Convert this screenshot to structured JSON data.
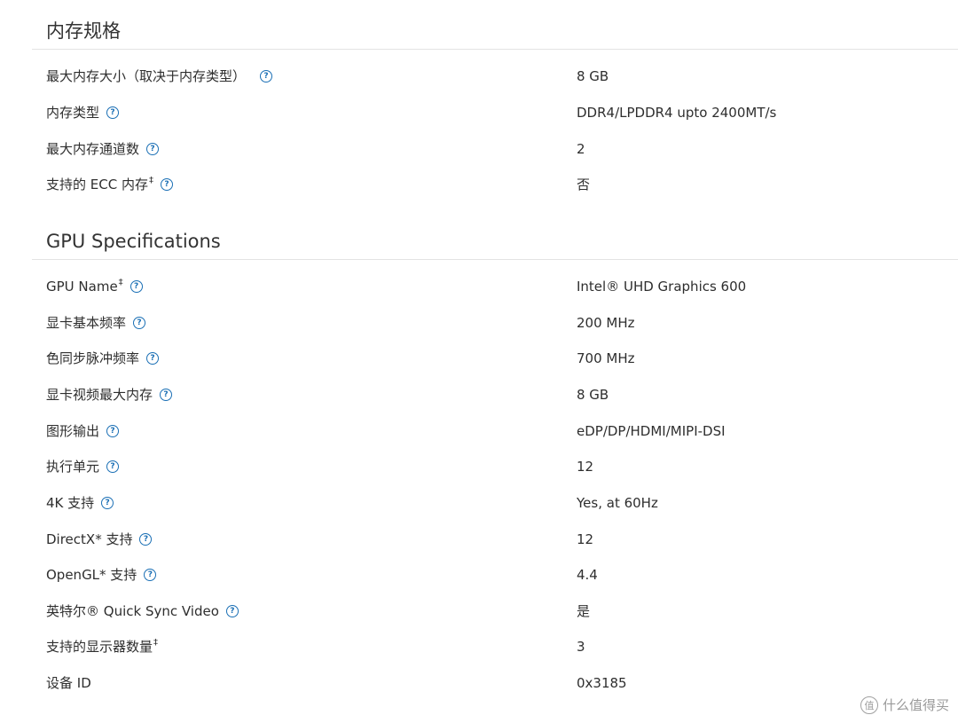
{
  "memory_section": {
    "title": "内存规格",
    "rows": [
      {
        "label": "最大内存大小（取决于内存类型）",
        "mark": "",
        "value": "8 GB",
        "help": true
      },
      {
        "label": "内存类型",
        "mark": "",
        "value": "DDR4/LPDDR4 upto 2400MT/s",
        "help": true
      },
      {
        "label": "最大内存通道数",
        "mark": "",
        "value": "2",
        "help": true
      },
      {
        "label": "支持的 ECC 内存",
        "mark": "‡",
        "value": "否",
        "help": true
      }
    ]
  },
  "gpu_section": {
    "title": "GPU Specifications",
    "rows": [
      {
        "label": "GPU Name",
        "mark": "‡",
        "value": "Intel® UHD Graphics 600",
        "help": true
      },
      {
        "label": "显卡基本频率",
        "mark": "",
        "value": "200 MHz",
        "help": true
      },
      {
        "label": "色同步脉冲频率",
        "mark": "",
        "value": "700 MHz",
        "help": true
      },
      {
        "label": "显卡视频最大内存",
        "mark": "",
        "value": "8 GB",
        "help": true
      },
      {
        "label": "图形输出",
        "mark": "",
        "value": "eDP/DP/HDMI/MIPI-DSI",
        "help": true
      },
      {
        "label": "执行单元",
        "mark": "",
        "value": "12",
        "help": true
      },
      {
        "label": "4K 支持",
        "mark": "",
        "value": "Yes, at 60Hz",
        "help": true
      },
      {
        "label": "DirectX* 支持",
        "mark": "",
        "value": "12",
        "help": true
      },
      {
        "label": "OpenGL* 支持",
        "mark": "",
        "value": "4.4",
        "help": true
      },
      {
        "label": "英特尔® Quick Sync Video",
        "mark": "",
        "value": "是",
        "help": true
      },
      {
        "label": "支持的显示器数量",
        "mark": "‡",
        "value": "3",
        "help": false
      },
      {
        "label": "设备 ID",
        "mark": "",
        "value": "0x3185",
        "help": false
      }
    ]
  },
  "help_icon_glyph": "?",
  "watermark": {
    "logo_glyph": "值",
    "text": "什么值得买"
  }
}
